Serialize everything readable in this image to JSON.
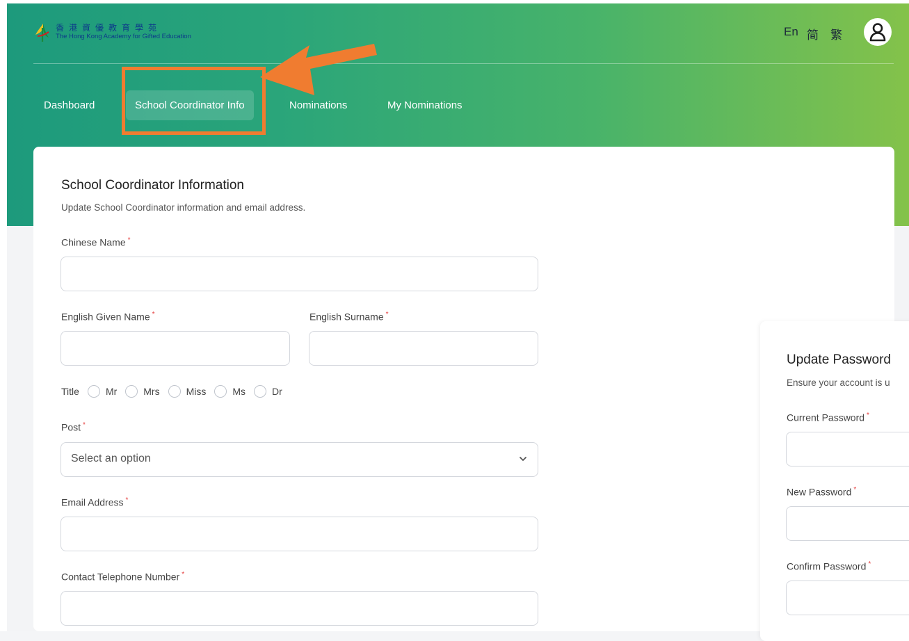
{
  "header": {
    "logo_zh": "香港資優教育學苑",
    "logo_en": "The Hong Kong Academy for Gifted Education",
    "lang_en": "En",
    "lang_zhs": "简",
    "lang_zht": "繁"
  },
  "nav": {
    "items": [
      {
        "label": "Dashboard"
      },
      {
        "label": "School Coordinator Info"
      },
      {
        "label": "Nominations"
      },
      {
        "label": "My Nominations"
      }
    ],
    "active_index": 1
  },
  "coordinator_form": {
    "title": "School Coordinator Information",
    "subtitle": "Update School Coordinator information and email address.",
    "chinese_name_label": "Chinese Name",
    "given_name_label": "English Given Name",
    "surname_label": "English Surname",
    "title_label": "Title",
    "title_options": [
      "Mr",
      "Mrs",
      "Miss",
      "Ms",
      "Dr"
    ],
    "post_label": "Post",
    "post_placeholder": "Select an option",
    "email_label": "Email Address",
    "phone_label": "Contact Telephone Number",
    "required_mark": "*"
  },
  "password_form": {
    "title": "Update Password",
    "subtitle": "Ensure your account is u",
    "current_label": "Current Password",
    "new_label": "New Password",
    "confirm_label": "Confirm Password"
  },
  "colors": {
    "accent_highlight": "#f07c30",
    "gradient_start": "#1d9a7c",
    "gradient_end": "#84c24a"
  }
}
